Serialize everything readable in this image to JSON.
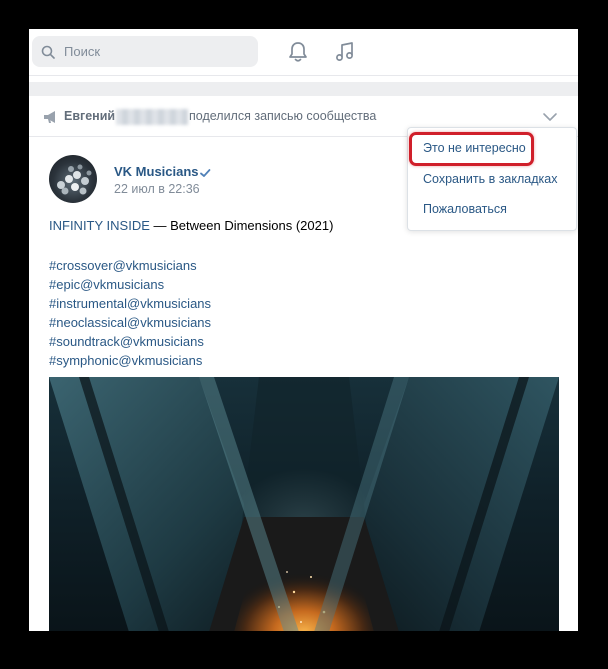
{
  "search": {
    "placeholder": "Поиск"
  },
  "repost": {
    "author_first_name": "Евгений",
    "action_text": "поделился записью сообщества"
  },
  "post": {
    "author": "VK Musicians",
    "date": "22 июл в 22:36",
    "title_artist": "INFINITY INSIDE",
    "title_rest": " — Between Dimensions (2021)",
    "hashtags": [
      "#crossover@vkmusicians",
      "#epic@vkmusicians",
      "#instrumental@vkmusicians",
      "#neoclassical@vkmusicians",
      "#soundtrack@vkmusicians",
      "#symphonic@vkmusicians"
    ]
  },
  "menu": {
    "items": [
      "Это не интересно",
      "Сохранить в закладках",
      "Пожаловаться"
    ]
  },
  "colors": {
    "link": "#2a5885",
    "secondary_text": "#818c99",
    "highlight": "#d01f2a",
    "search_bg": "#edeef0"
  }
}
